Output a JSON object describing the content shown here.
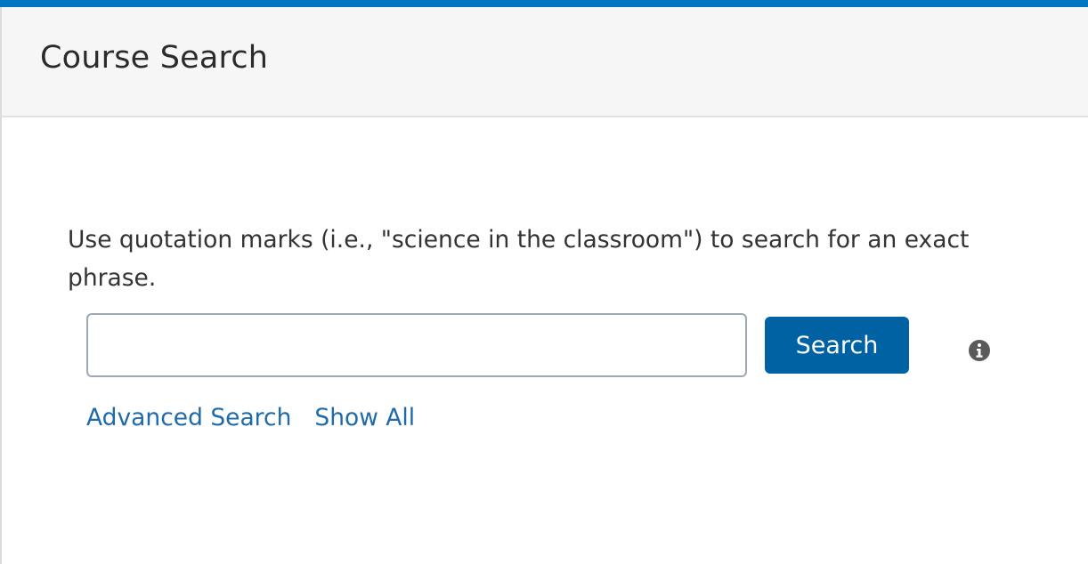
{
  "header": {
    "title": "Course Search"
  },
  "search": {
    "hint": "Use quotation marks (i.e., \"science in the classroom\") to search for an exact phrase.",
    "value": "",
    "placeholder": "",
    "button_label": "Search",
    "info_icon": "info-circle-icon"
  },
  "links": {
    "advanced": "Advanced Search",
    "show_all": "Show All"
  },
  "colors": {
    "accent": "#0076c0",
    "button": "#0062a3",
    "link": "#1f6aa8",
    "header_bg": "#f6f6f6"
  }
}
